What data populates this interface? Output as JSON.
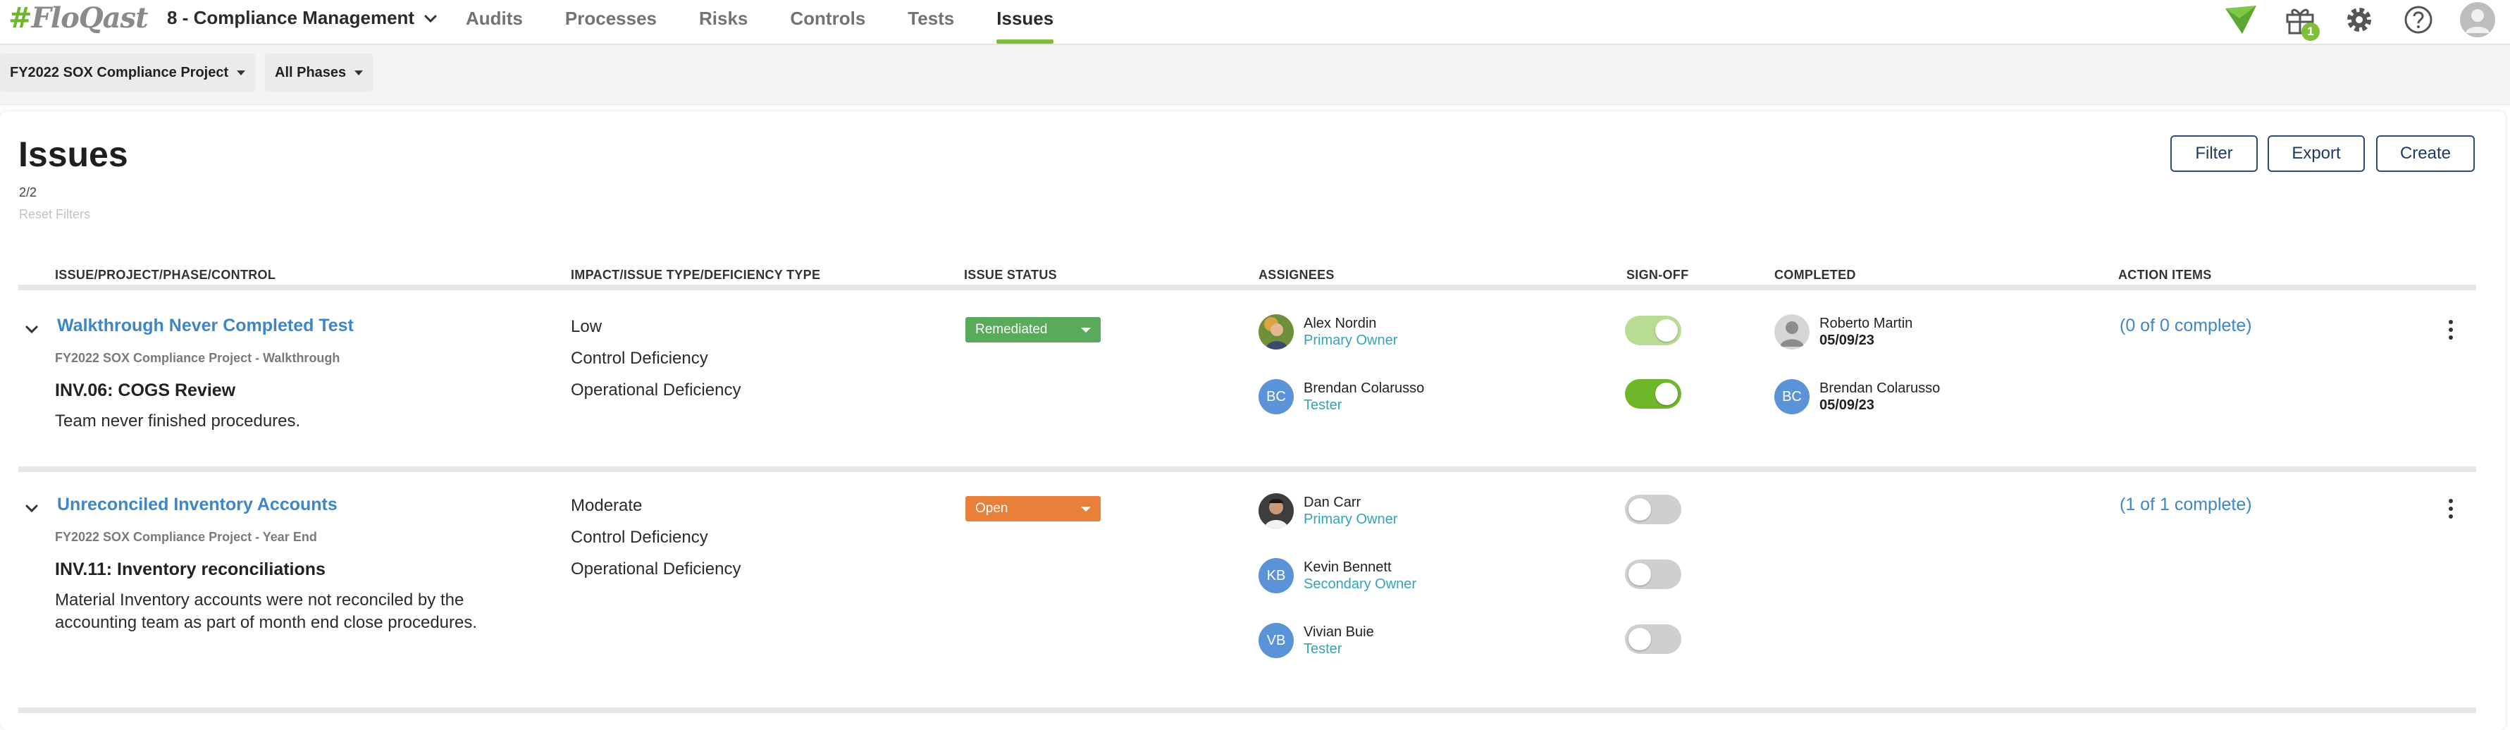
{
  "app": {
    "logo": "FloQast",
    "module": "8 - Compliance Management",
    "nav_tabs": [
      "Audits",
      "Processes",
      "Risks",
      "Controls",
      "Tests",
      "Issues"
    ],
    "active_tab": "Issues",
    "gift_badge": "1",
    "accent_color": "#7fbd3a"
  },
  "filters": {
    "project": "FY2022 SOX Compliance Project",
    "phase": "All Phases"
  },
  "page": {
    "title": "Issues",
    "count": "2/2",
    "reset_filters": "Reset Filters",
    "buttons": {
      "filter": "Filter",
      "export": "Export",
      "create": "Create"
    }
  },
  "table": {
    "columns": [
      "ISSUE/PROJECT/PHASE/CONTROL",
      "IMPACT/ISSUE TYPE/DEFICIENCY TYPE",
      "ISSUE STATUS",
      "ASSIGNEES",
      "SIGN-OFF",
      "COMPLETED",
      "ACTION ITEMS"
    ],
    "rows": [
      {
        "title": "Walkthrough Never Completed Test",
        "project_phase": "FY2022 SOX Compliance Project - Walkthrough",
        "control": "INV.06: COGS Review",
        "description": "Team never finished procedures.",
        "impact": "Low",
        "issue_type": "Control Deficiency",
        "deficiency_type": "Operational Deficiency",
        "status": "Remediated",
        "status_color": "#5aaa5c",
        "assignees": [
          {
            "name": "Alex Nordin",
            "role": "Primary Owner",
            "initials": "",
            "signed": true
          },
          {
            "name": "Brendan Colarusso",
            "role": "Tester",
            "initials": "BC",
            "signed": true
          }
        ],
        "completed": [
          {
            "name": "Roberto Martin",
            "date": "05/09/23",
            "initials": ""
          },
          {
            "name": "Brendan Colarusso",
            "date": "05/09/23",
            "initials": "BC"
          }
        ],
        "action_items": "(0 of 0 complete)"
      },
      {
        "title": "Unreconciled Inventory Accounts",
        "project_phase": "FY2022 SOX Compliance Project - Year End",
        "control": "INV.11: Inventory reconciliations",
        "description": "Material Inventory accounts were not reconciled by the accounting team as part of month end close procedures.",
        "impact": "Moderate",
        "issue_type": "Control Deficiency",
        "deficiency_type": "Operational Deficiency",
        "status": "Open",
        "status_color": "#e8803a",
        "assignees": [
          {
            "name": "Dan Carr",
            "role": "Primary Owner",
            "initials": "",
            "signed": false
          },
          {
            "name": "Kevin Bennett",
            "role": "Secondary Owner",
            "initials": "KB",
            "signed": false
          },
          {
            "name": "Vivian Buie",
            "role": "Tester",
            "initials": "VB",
            "signed": false
          }
        ],
        "completed": [],
        "action_items": "(1 of 1 complete)"
      }
    ]
  }
}
